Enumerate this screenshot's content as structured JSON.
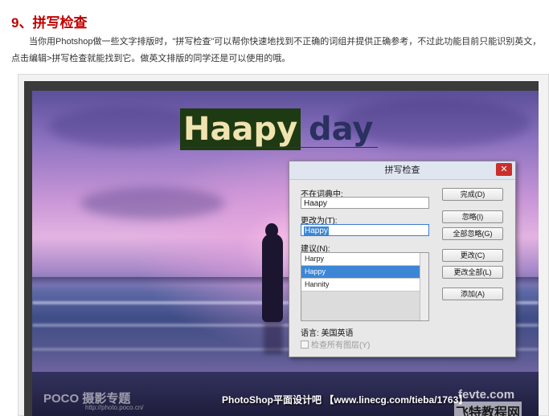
{
  "article": {
    "heading": "9、拼写检查",
    "paragraph": "当你用Photshop做一些文字排版时，\"拼写检查\"可以帮你快速地找到不正确的词组并提供正确参考，不过此功能目前只能识别英文，点击编辑>拼写检查就能找到它。做英文排版的同学还是可以使用的哦。"
  },
  "canvas": {
    "title_misspelled": "Haapy",
    "title_rest": "day"
  },
  "dialog": {
    "title": "拼写检查",
    "close_symbol": "✕",
    "not_in_dictionary_label": "不在词典中:",
    "not_in_dictionary_value": "Haapy",
    "change_to_label": "更改为(T):",
    "change_to_value": "Happy",
    "suggestions_label": "建议(N):",
    "suggestions": [
      "Harpy",
      "Happy",
      "Hannity"
    ],
    "selected_suggestion": 1,
    "buttons": {
      "done": "完成(D)",
      "ignore": "忽略(I)",
      "ignore_all": "全部忽略(G)",
      "change": "更改(C)",
      "change_all": "更改全部(L)",
      "add": "添加(A)"
    },
    "language_label": "语言: 美国英语",
    "check_all_layers": "检查所有图层(Y)"
  },
  "watermarks": {
    "poco": "POCO 摄影专题",
    "poco_url": "http://photo.poco.cn/",
    "center": "PhotoShop平面设计吧 【www.linecg.com/tieba/1763】",
    "corner": "fevte.com",
    "brand": "飞特教程网"
  },
  "colors": {
    "heading": "#c00000",
    "selection": "#3d86d6",
    "close_button": "#c9302c"
  }
}
